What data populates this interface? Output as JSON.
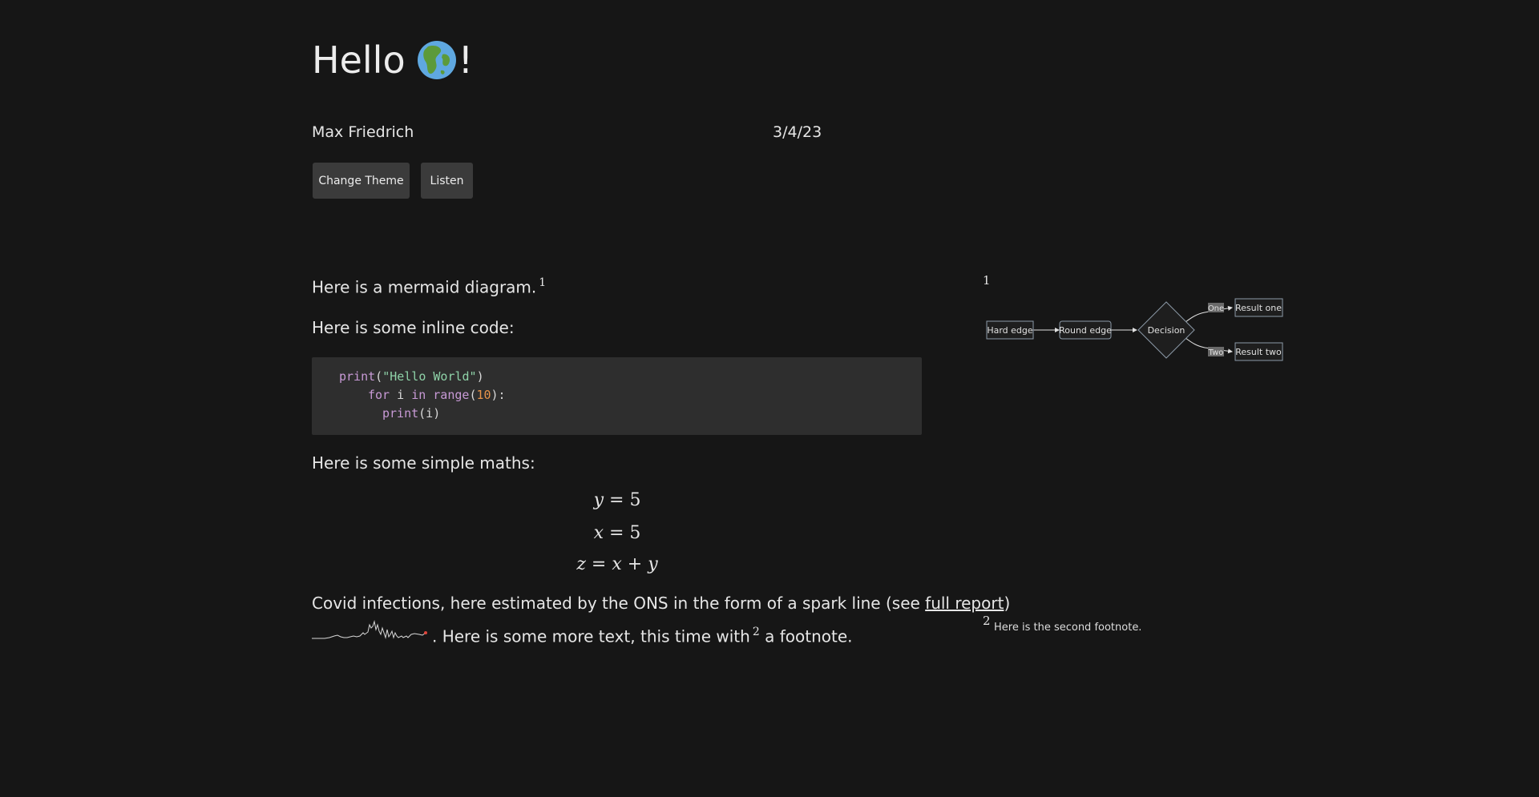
{
  "header": {
    "title_text": "Hello",
    "title_suffix": "!",
    "globe_icon": "earth-globe-emoji",
    "author": "Max Friedrich",
    "date": "3/4/23"
  },
  "buttons": {
    "change_theme": "Change Theme",
    "listen": "Listen"
  },
  "content": {
    "mermaid_intro": "Here is a mermaid diagram.",
    "footnote_1_marker": "1",
    "inline_code_intro": "Here is some inline code:",
    "maths_intro": "Here is some simple maths:",
    "covid_text_before_link": "Covid infections, here estimated by the ONS in the form of a spark line (see ",
    "covid_link": "full report",
    "covid_text_after_link": ")",
    "more_text_before": ". Here is some more text, this time with",
    "footnote_2_marker": "2",
    "more_text_after": " a footnote."
  },
  "code": {
    "lines": [
      "print(\"Hello World\")",
      "for i in range(10):",
      "print(i)"
    ]
  },
  "maths": {
    "eq1": "y = 5",
    "eq2": "x = 5",
    "eq3": "z = x + y"
  },
  "sidenotes": {
    "note1_number": "1",
    "note2_number": "2",
    "note2_text": "Here is the second footnote."
  },
  "diagram": {
    "nodes": {
      "hard_edge": "Hard edge",
      "round_edge": "Round edge",
      "decision": "Decision",
      "result_one": "Result one",
      "result_two": "Result two"
    },
    "edge_labels": {
      "one": "One",
      "two": "Two"
    }
  },
  "colors": {
    "background": "#161616",
    "code_background": "#2e2e2e",
    "button_background": "#3b3b3b",
    "keyword": "#c89ad6",
    "string": "#8fd3a8",
    "number": "#e8944a",
    "spark_end_marker": "#e0443a"
  }
}
